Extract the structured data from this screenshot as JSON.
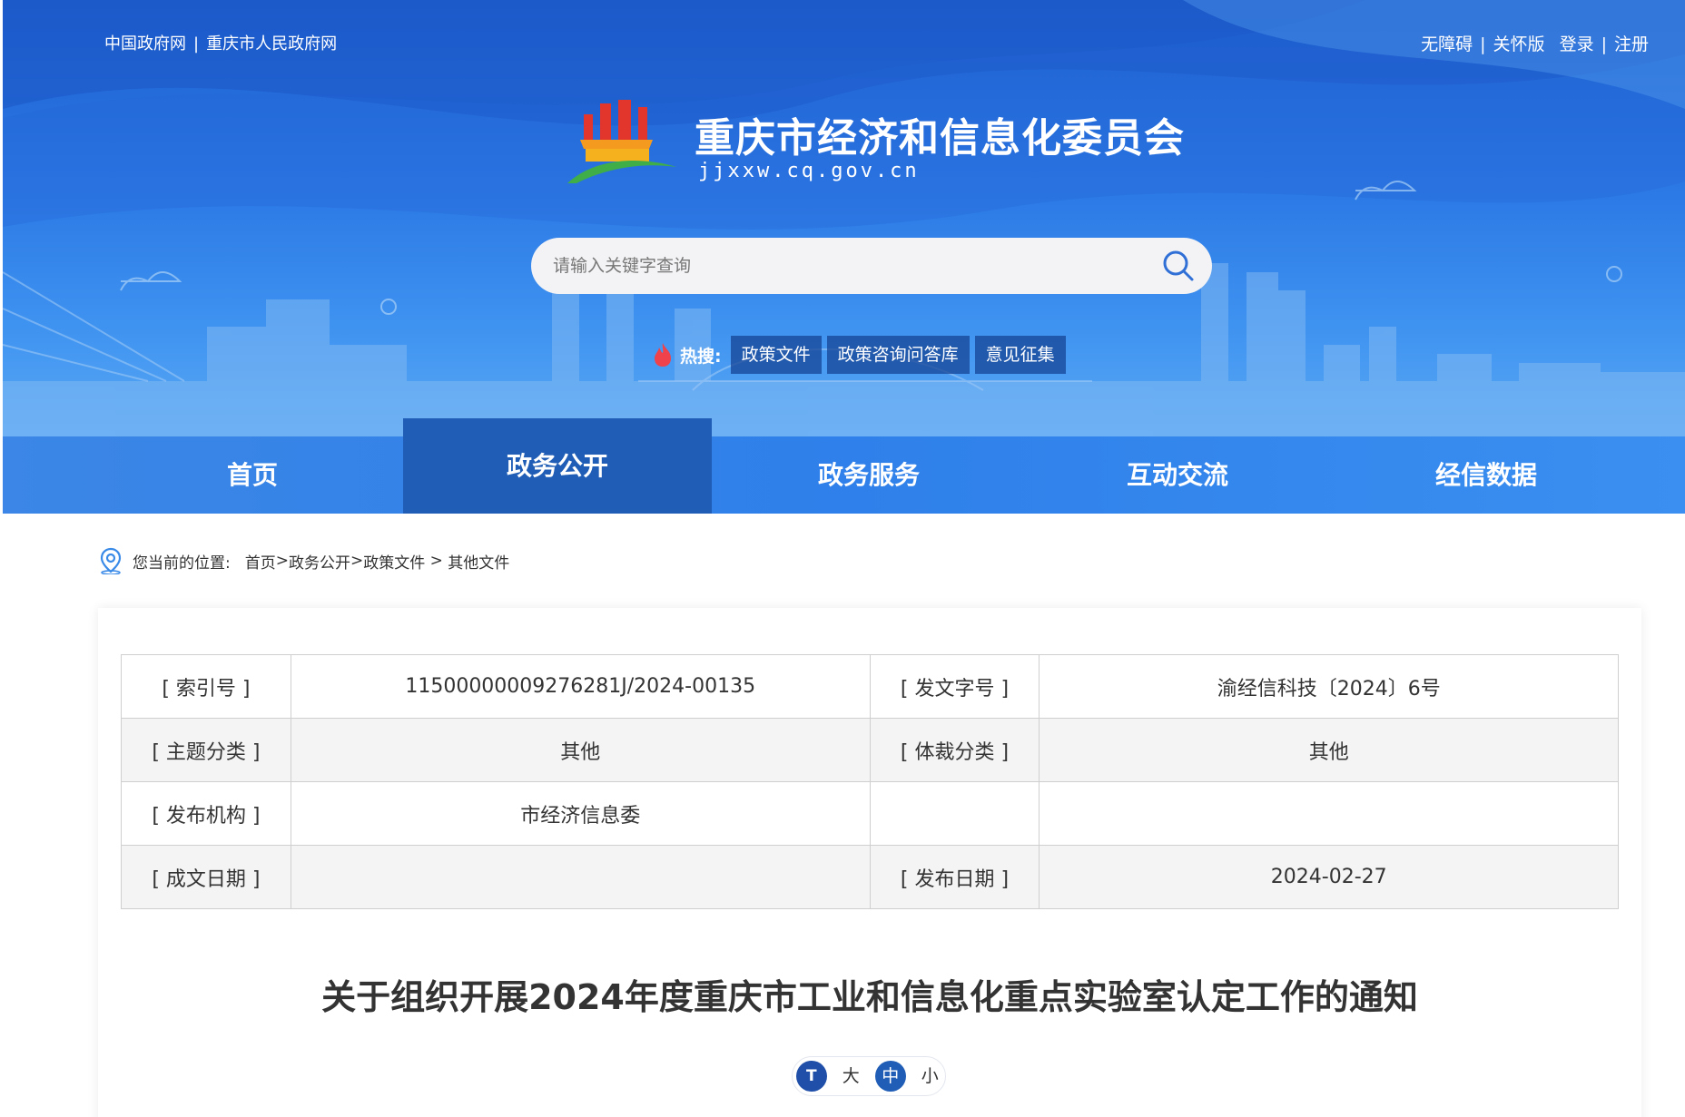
{
  "top_links_left": [
    "中国政府网",
    "重庆市人民政府网"
  ],
  "top_links_right": [
    "无障碍",
    "关怀版",
    "登录",
    "注册"
  ],
  "site": {
    "title": "重庆市经济和信息化委员会",
    "domain": "jjxxw.cq.gov.cn"
  },
  "search": {
    "placeholder": "请输入关键字查询"
  },
  "hot": {
    "label": "热搜:",
    "tags": [
      "政策文件",
      "政策咨询问答库",
      "意见征集"
    ]
  },
  "nav": [
    "首页",
    "政务公开",
    "政务服务",
    "互动交流",
    "经信数据"
  ],
  "nav_active": "政务公开",
  "breadcrumb": {
    "prefix": "您当前的位置:",
    "items": [
      "首页",
      "政务公开",
      "政策文件",
      "其他文件"
    ]
  },
  "meta": {
    "index_label": "[ 索引号 ]",
    "index_value": "11500000009276281J/2024-00135",
    "docno_label": "[ 发文字号 ]",
    "docno_value": "渝经信科技〔2024〕6号",
    "topic_label": "[ 主题分类 ]",
    "topic_value": "其他",
    "genre_label": "[ 体裁分类 ]",
    "genre_value": "其他",
    "org_label": "[ 发布机构 ]",
    "org_value": "市经济信息委",
    "created_label": "[ 成文日期 ]",
    "created_value": "",
    "published_label": "[ 发布日期 ]",
    "published_value": "2024-02-27"
  },
  "article": {
    "title": "关于组织开展2024年度重庆市工业和信息化重点实验室认定工作的通知"
  },
  "fontsize": {
    "icon": "T",
    "options": [
      "大",
      "中",
      "小"
    ],
    "selected": "中"
  },
  "colors": {
    "banner": "#2c7ae6",
    "nav": "#2f7ae3",
    "nav_active": "#1f5db6"
  }
}
